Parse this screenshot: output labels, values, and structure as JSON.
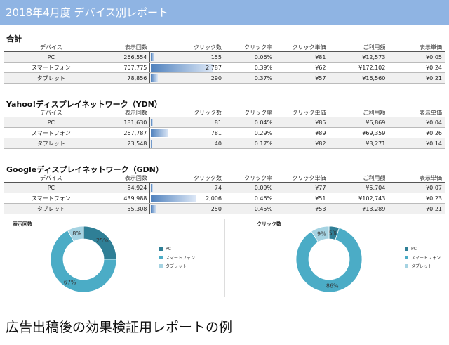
{
  "report_title": "2018年4月度 デバイス別レポート",
  "columns": [
    "デバイス",
    "表示回数",
    "クリック数",
    "クリック率",
    "クリック単価",
    "ご利用額",
    "表示単価"
  ],
  "sections": [
    {
      "title": "合計",
      "rows": [
        {
          "device": "PC",
          "impressions": "266,554",
          "clicks": "155",
          "clicks_value": 155,
          "ctr": "0.06%",
          "cpc": "¥81",
          "cost": "¥12,573",
          "cpm": "¥0.05"
        },
        {
          "device": "スマートフォン",
          "impressions": "707,775",
          "clicks": "2,787",
          "clicks_value": 2787,
          "ctr": "0.39%",
          "cpc": "¥62",
          "cost": "¥172,102",
          "cpm": "¥0.24"
        },
        {
          "device": "タブレット",
          "impressions": "78,856",
          "clicks": "290",
          "clicks_value": 290,
          "ctr": "0.37%",
          "cpc": "¥57",
          "cost": "¥16,560",
          "cpm": "¥0.21"
        }
      ]
    },
    {
      "title": "Yahoo!ディスプレイネットワーク（YDN）",
      "rows": [
        {
          "device": "PC",
          "impressions": "181,630",
          "clicks": "81",
          "clicks_value": 81,
          "ctr": "0.04%",
          "cpc": "¥85",
          "cost": "¥6,869",
          "cpm": "¥0.04"
        },
        {
          "device": "スマートフォン",
          "impressions": "267,787",
          "clicks": "781",
          "clicks_value": 781,
          "ctr": "0.29%",
          "cpc": "¥89",
          "cost": "¥69,359",
          "cpm": "¥0.26"
        },
        {
          "device": "タブレット",
          "impressions": "23,548",
          "clicks": "40",
          "clicks_value": 40,
          "ctr": "0.17%",
          "cpc": "¥82",
          "cost": "¥3,271",
          "cpm": "¥0.14"
        }
      ]
    },
    {
      "title": "Googleディスプレイネットワーク（GDN）",
      "rows": [
        {
          "device": "PC",
          "impressions": "84,924",
          "clicks": "74",
          "clicks_value": 74,
          "ctr": "0.09%",
          "cpc": "¥77",
          "cost": "¥5,704",
          "cpm": "¥0.07"
        },
        {
          "device": "スマートフォン",
          "impressions": "439,988",
          "clicks": "2,006",
          "clicks_value": 2006,
          "ctr": "0.46%",
          "cpc": "¥51",
          "cost": "¥102,743",
          "cpm": "¥0.23"
        },
        {
          "device": "タブレット",
          "impressions": "55,308",
          "clicks": "250",
          "clicks_value": 250,
          "ctr": "0.45%",
          "cpc": "¥53",
          "cost": "¥13,289",
          "cpm": "¥0.21"
        }
      ]
    }
  ],
  "bar_max": 2787,
  "bar_color": "#4f81bd",
  "chart_data": [
    {
      "type": "pie",
      "title": "表示回数",
      "categories": [
        "PC",
        "スマートフォン",
        "タブレット"
      ],
      "values": [
        25,
        67,
        8
      ],
      "labels": [
        "25%",
        "67%",
        "8%"
      ],
      "colors": [
        "#2f7f96",
        "#4bacc6",
        "#a5d3e2"
      ],
      "legend": "right"
    },
    {
      "type": "pie",
      "title": "クリック数",
      "categories": [
        "PC",
        "スマートフォン",
        "タブレット"
      ],
      "values": [
        5,
        86,
        9
      ],
      "labels": [
        "5%",
        "86%",
        "9%"
      ],
      "colors": [
        "#2f7f96",
        "#4bacc6",
        "#a5d3e2"
      ],
      "legend": "right"
    }
  ],
  "caption": "広告出稿後の効果検証用レポートの例"
}
